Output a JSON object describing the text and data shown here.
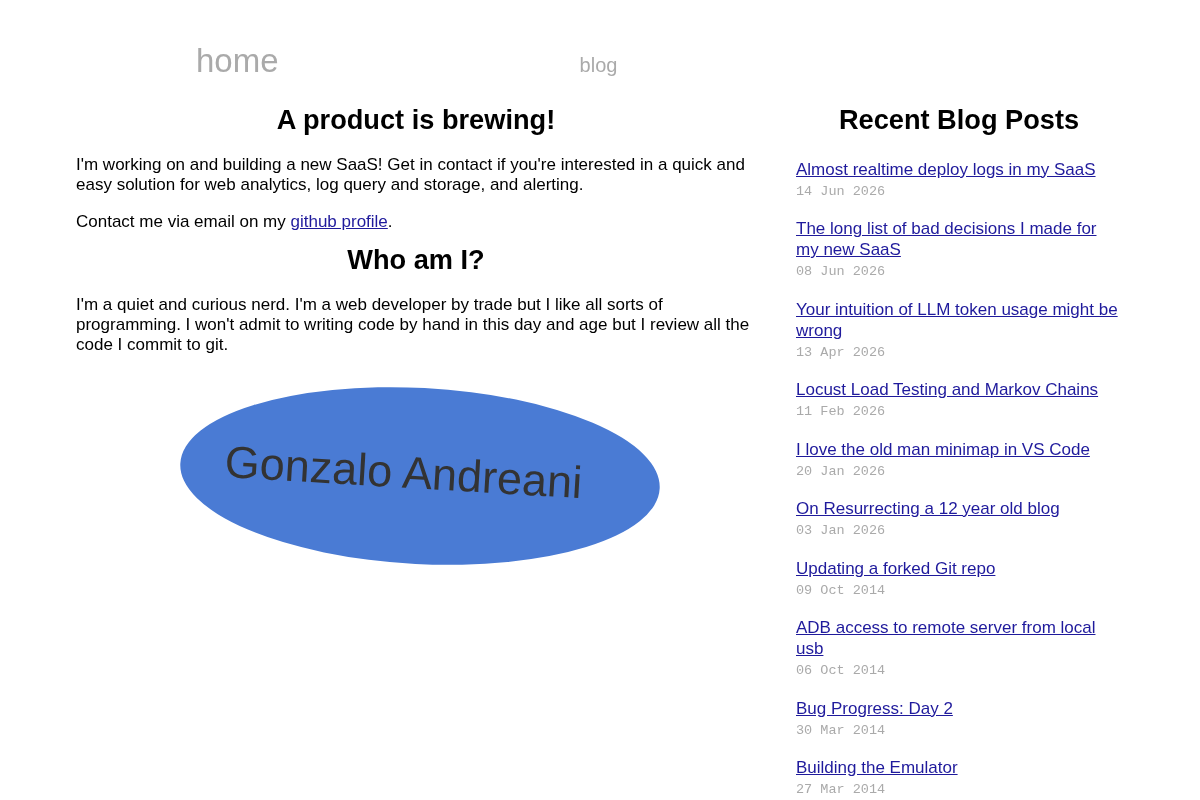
{
  "nav": [
    {
      "label": "home",
      "kind": "title"
    },
    {
      "label": "blog",
      "kind": "link"
    }
  ],
  "sections": [
    {
      "heading": "A product is brewing!",
      "paragraphs": [
        [
          {
            "text": "I'm working on and building a new SaaS! Get in contact if you're interested in a quick and easy solution for web analytics, log query and storage, and alerting."
          }
        ],
        [
          {
            "text": "Contact me via email on my "
          },
          {
            "link": "github profile"
          },
          {
            "text": "."
          }
        ]
      ]
    },
    {
      "heading": "Who am I?",
      "paragraphs": [
        [
          {
            "text": "I'm a quiet and curious nerd. I'm a web developer by trade but I like all sorts of programming. I won't admit to writing code by hand in this day and age but I review all the code I commit to git."
          }
        ]
      ]
    }
  ],
  "logo": {
    "text": "Gonzalo Andreani"
  },
  "sidebar": {
    "heading": "Recent Blog Posts",
    "posts": [
      {
        "title": "Almost realtime deploy logs in my SaaS",
        "date": "14 Jun 2026"
      },
      {
        "title": "The long list of bad decisions I made for my new SaaS",
        "date": "08 Jun 2026"
      },
      {
        "title": "Your intuition of LLM token usage might be wrong",
        "date": "13 Apr 2026"
      },
      {
        "title": "Locust Load Testing and Markov Chains",
        "date": "11 Feb 2026"
      },
      {
        "title": "I love the old man minimap in VS Code",
        "date": "20 Jan 2026"
      },
      {
        "title": "On Resurrecting a 12 year old blog",
        "date": "03 Jan 2026"
      },
      {
        "title": "Updating a forked Git repo",
        "date": "09 Oct 2014"
      },
      {
        "title": "ADB access to remote server from local usb",
        "date": "06 Oct 2014"
      },
      {
        "title": "Bug Progress: Day 2",
        "date": "30 Mar 2014"
      },
      {
        "title": "Building the Emulator",
        "date": "27 Mar 2014"
      }
    ]
  }
}
